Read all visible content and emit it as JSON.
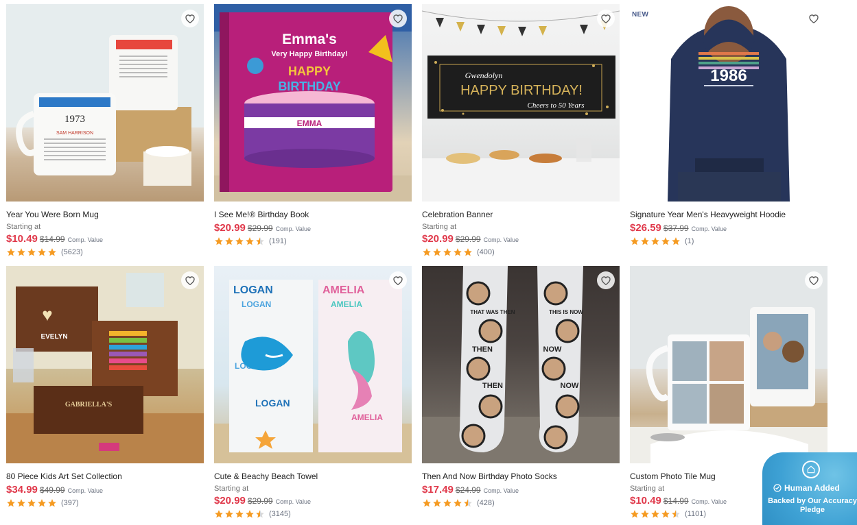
{
  "products": [
    {
      "title": "Year You Were Born Mug",
      "starting": "Starting at",
      "price": "$10.49",
      "orig": "$14.99",
      "comp": "Comp. Value",
      "reviews": "(5623)",
      "stars": 5,
      "image": {
        "year": "1973",
        "name": "SAM HARRISON",
        "caption": "The Year You Were Born"
      }
    },
    {
      "title": "I See Me!® Birthday Book",
      "starting": "",
      "price": "$20.99",
      "orig": "$29.99",
      "comp": "Comp. Value",
      "reviews": "(191)",
      "stars": 4.5,
      "image": {
        "heading": "Emma's",
        "sub": "Very Happy Birthday!",
        "word1": "HAPPY",
        "word2": "BIRTHDAY",
        "name": "EMMA"
      }
    },
    {
      "title": "Celebration Banner",
      "starting": "Starting at",
      "price": "$20.99",
      "orig": "$29.99",
      "comp": "Comp. Value",
      "reviews": "(400)",
      "stars": 5,
      "image": {
        "name": "Gwendolyn",
        "heading": "HAPPY BIRTHDAY!",
        "sub": "Cheers to 50 Years"
      }
    },
    {
      "title": "Signature Year Men's Heavyweight Hoodie",
      "starting": "",
      "price": "$26.59",
      "orig": "$37.99",
      "comp": "Comp. Value",
      "reviews": "(1)",
      "stars": 5,
      "badge": "NEW",
      "image": {
        "year": "1986"
      }
    },
    {
      "title": "80 Piece Kids Art Set Collection",
      "starting": "",
      "price": "$34.99",
      "orig": "$49.99",
      "comp": "Comp. Value",
      "reviews": "(397)",
      "stars": 5,
      "image": {
        "name": "EVELYN",
        "name2": "GABRIELLA'S"
      }
    },
    {
      "title": "Cute & Beachy Beach Towel",
      "starting": "Starting at",
      "price": "$20.99",
      "orig": "$29.99",
      "comp": "Comp. Value",
      "reviews": "(3145)",
      "stars": 4.5,
      "image": {
        "name1": "LOGAN",
        "name2": "AMELIA"
      }
    },
    {
      "title": "Then And Now Birthday Photo Socks",
      "starting": "",
      "price": "$17.49",
      "orig": "$24.99",
      "comp": "Comp. Value",
      "reviews": "(428)",
      "stars": 4.5,
      "image": {
        "left": "THAT WAS THEN",
        "right": "THIS IS NOW"
      }
    },
    {
      "title": "Custom Photo Tile Mug",
      "starting": "Starting at",
      "price": "$10.49",
      "orig": "$14.99",
      "comp": "Comp. Value",
      "reviews": "(1101)",
      "stars": 4.5,
      "image": {}
    }
  ],
  "pledge": {
    "title": "Human Added",
    "sub": "Backed by Our Accuracy Pledge"
  },
  "colors": {
    "price": "#e0384a",
    "star": "#f59b23",
    "pledge": "#3ea1d4"
  }
}
